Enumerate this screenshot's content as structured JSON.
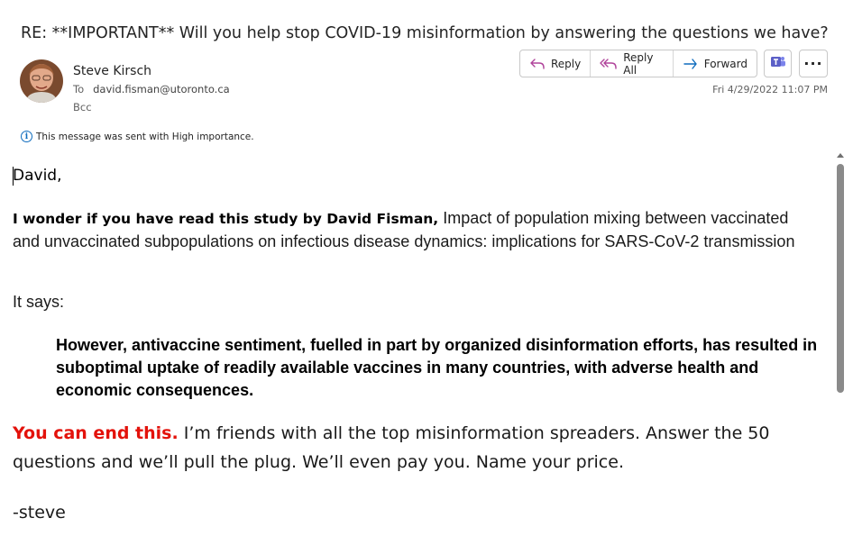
{
  "email": {
    "subject": "RE: **IMPORTANT** Will you help stop COVID-19 misinformation by answering the questions we have?",
    "sender_name": "Steve Kirsch",
    "to_label": "To",
    "to_address": "david.fisman@utoronto.ca",
    "bcc_label": "Bcc",
    "date": "Fri 4/29/2022 11:07 PM",
    "importance_notice": "This message was sent with High importance."
  },
  "actions": {
    "reply_label": "Reply",
    "reply_all_label": "Reply All",
    "forward_label": "Forward",
    "more_label": "···"
  },
  "body": {
    "greeting": "David,",
    "p1_bold": "I wonder if you have read this study by David Fisman,",
    "p1_rest": " Impact of population mixing between vaccinated and unvaccinated subpopulations on infectious disease dynamics: implications for SARS-CoV-2 transmission",
    "it_says": "It says:",
    "quote": "However, antivaccine sentiment, fuelled in part by organized disinformation efforts, has resulted in suboptimal uptake of readily available vaccines in many countries, with adverse health and economic consequences.",
    "closing_red": "You can end this.",
    "closing_rest": " I’m friends with all the top misinformation spreaders. Answer the 50 questions and we’ll pull the plug. We’ll even pay you. Name your price.",
    "signoff": "-steve"
  },
  "icons": {
    "reply": "reply-icon",
    "reply_all": "reply-all-icon",
    "forward": "forward-icon",
    "teams": "teams-icon",
    "info": "info-icon"
  },
  "colors": {
    "accent": "#0f6cbd",
    "reply_icon": "#b0449b",
    "forward_icon": "#0f6cbd",
    "teams": "#5b5fc7",
    "red_text": "#e3120b"
  }
}
